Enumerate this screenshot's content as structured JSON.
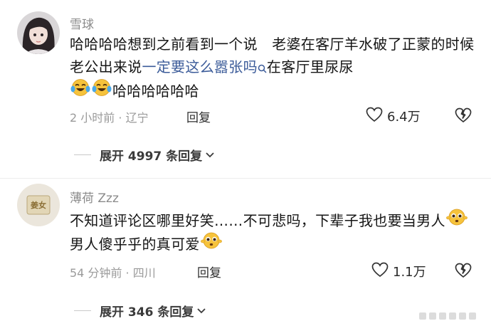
{
  "comments": [
    {
      "username": "雪球",
      "content_parts": {
        "a": "哈哈哈哈想到之前看到一个说　老婆在客厅羊水破了正蒙的时候老公出来说",
        "link": "一定要这么嚣张吗",
        "b": "在客厅里尿尿",
        "c": "哈哈哈哈哈哈"
      },
      "emojis": [
        "crying-laughing-emoji",
        "crying-laughing-emoji"
      ],
      "time": "2 小时前",
      "location": "辽宁",
      "reply_label": "回复",
      "like_count": "6.4万",
      "expand_label": "展开 4997 条回复"
    },
    {
      "username": "薄荷 Zzz",
      "content_parts": {
        "a": "不知道评论区哪里好笑……不可悲吗，下辈子我也要当男人",
        "b": "男人傻乎乎的真可爱"
      },
      "emojis": [
        "flushed-pleading-emoji",
        "flushed-pleading-emoji"
      ],
      "time": "54 分钟前",
      "location": "四川",
      "reply_label": "回复",
      "like_count": "1.1万",
      "expand_label": "展开 346 条回复"
    }
  ],
  "avatar_badge_text": "姜女",
  "meta_separator": "·",
  "colors": {
    "link": "#3b5b99",
    "meta": "#9a9a9a",
    "username": "#8a8a8a",
    "emoji": "#f6c33c"
  }
}
